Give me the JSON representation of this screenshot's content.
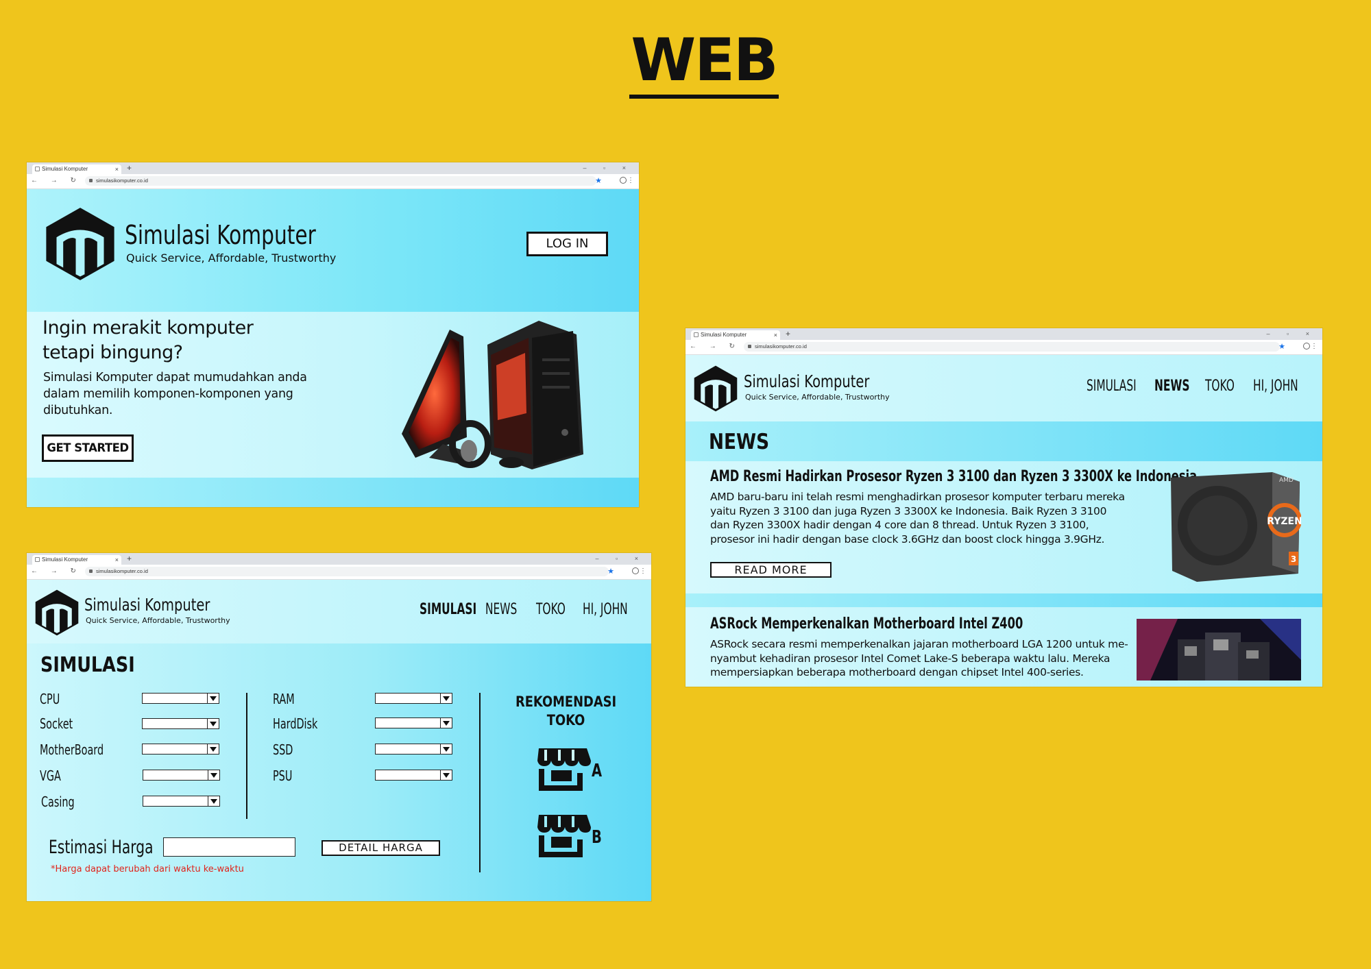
{
  "title": "WEB",
  "brand": {
    "name": "Simulasi Komputer",
    "tagline": "Quick Service, Affordable, Trustworthy"
  },
  "browser": {
    "tab_title": "Simulasi Komputer",
    "url_main": "simulasikomputer.co.id",
    "url_news": "simulasikomputer.co.id",
    "new_tab": "+",
    "window_controls": "– ▫ ×",
    "nav_glyphs": "← → ↻ ⌂",
    "bookmark": "★",
    "menu": "⋮",
    "tab_close": "×"
  },
  "landing": {
    "login": "LOG IN",
    "headline": "Ingin merakit komputer tetapi bingung?",
    "description": "Simulasi Komputer dapat mumudahkan anda dalam memilih komponen-komponen yang dibutuhkan.",
    "cta": "GET STARTED"
  },
  "nav": {
    "items": [
      "SIMULASI",
      "NEWS",
      "TOKO",
      "HI, JOHN"
    ]
  },
  "simulasi": {
    "title": "SIMULASI",
    "left_fields": [
      "CPU",
      "Socket",
      "MotherBoard",
      "VGA",
      "Casing"
    ],
    "right_fields": [
      "RAM",
      "HardDisk",
      "SSD",
      "PSU"
    ],
    "recommend_title": "REKOMENDASI TOKO",
    "stores": [
      "A",
      "B"
    ],
    "estimate_label": "Estimasi Harga",
    "estimate_value": "",
    "detail_button": "DETAIL HARGA",
    "note": "*Harga dapat berubah dari waktu ke-waktu"
  },
  "news": {
    "title": "NEWS",
    "articles": [
      {
        "title": "AMD Resmi Hadirkan Prosesor Ryzen 3 3100 dan Ryzen 3 3300X ke Indonesia",
        "body": "AMD baru-baru ini telah resmi menghadirkan prosesor komputer terbaru mereka yaitu Ryzen 3 3100 dan juga Ryzen 3 3300X ke Indonesia. Baik Ryzen 3 3100 dan Ryzen 3300X hadir dengan 4 core dan 8 thread. Untuk Ryzen 3 3100, prosesor ini hadir dengan base clock 3.6GHz dan boost clock hingga 3.9GHz.",
        "read_more": "READ MORE",
        "box_brand": "AMD",
        "box_label": "RYZEN",
        "box_num": "3"
      },
      {
        "title": "ASRock Memperkenalkan Motherboard Intel Z400",
        "body": "ASRock secara resmi memperkenalkan jajaran motherboard LGA 1200 untuk me-nyambut kehadiran prosesor Intel Comet Lake-S beberapa waktu lalu. Mereka mempersiapkan beberapa motherboard dengan chipset Intel 400-series."
      }
    ]
  },
  "colors": {
    "background": "#efc51c",
    "accent_cyan": "#5ed9f6",
    "note_red": "#e0241b"
  }
}
